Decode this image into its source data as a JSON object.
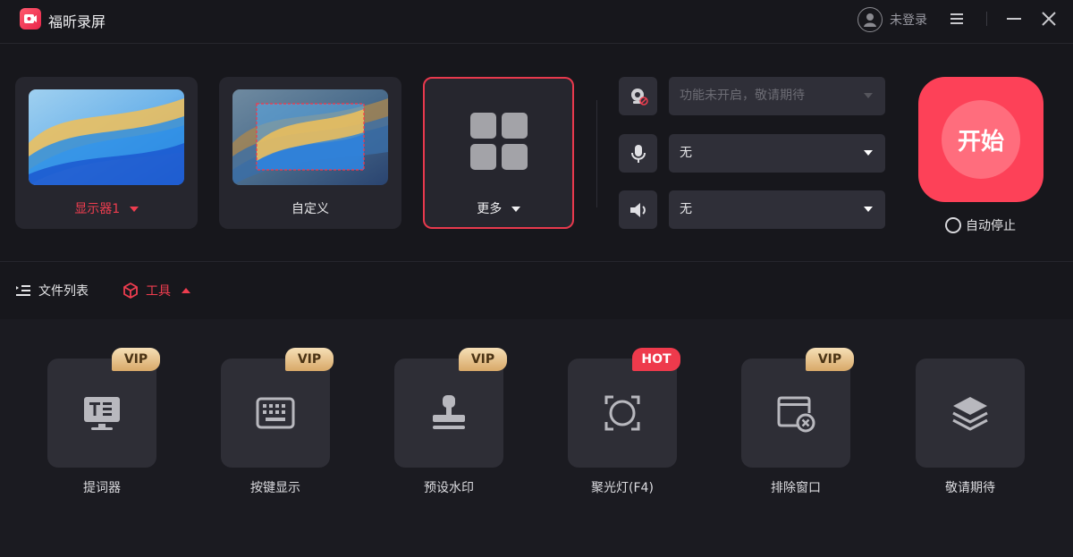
{
  "app": {
    "title": "福昕录屏",
    "accent": "#ee3d4f"
  },
  "header": {
    "login_text": "未登录",
    "icons": [
      "user-avatar-icon",
      "menu-icon",
      "minimize-icon",
      "close-icon"
    ]
  },
  "sources": {
    "monitor_label": "显示器1",
    "custom_label": "自定义",
    "more_label": "更多"
  },
  "devices": {
    "camera": {
      "icon": "camera-off-icon",
      "value": "功能未开启，敬请期待",
      "disabled": true
    },
    "microphone": {
      "icon": "microphone-icon",
      "value": "无"
    },
    "speaker": {
      "icon": "speaker-icon",
      "value": "无"
    }
  },
  "start": {
    "label": "开始",
    "auto_stop_label": "自动停止"
  },
  "tabs": [
    {
      "label": "文件列表",
      "icon": "file-list-icon",
      "active": false
    },
    {
      "label": "工具",
      "icon": "cube-icon",
      "active": true
    }
  ],
  "tools": [
    {
      "label": "提词器",
      "badge": "VIP",
      "icon": "teleprompter-icon"
    },
    {
      "label": "按键显示",
      "badge": "VIP",
      "icon": "keyboard-icon"
    },
    {
      "label": "预设水印",
      "badge": "VIP",
      "icon": "stamp-icon"
    },
    {
      "label": "聚光灯(F4)",
      "badge": "HOT",
      "icon": "spotlight-icon"
    },
    {
      "label": "排除窗口",
      "badge": "VIP",
      "icon": "exclude-window-icon"
    },
    {
      "label": "敬请期待",
      "badge": "",
      "icon": "layers-icon"
    }
  ]
}
